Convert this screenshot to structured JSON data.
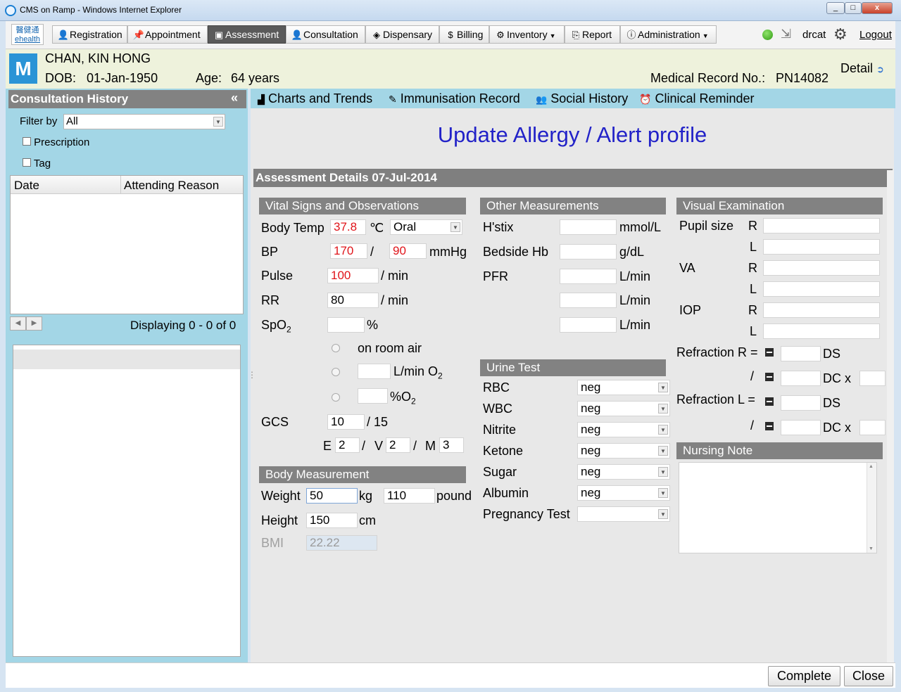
{
  "window": {
    "title": "CMS on Ramp - Windows Internet Explorer",
    "min": "_",
    "max": "□",
    "close": "x"
  },
  "logo": {
    "line1": "醫健通",
    "line2": "ehealth"
  },
  "nav": {
    "registration": "Registration",
    "appointment": "Appointment",
    "assessment": "Assessment",
    "consultation": "Consultation",
    "dispensary": "Dispensary",
    "billing": "Billing",
    "inventory": "Inventory",
    "report": "Report",
    "administration": "Administration",
    "user": "drcat",
    "logout": "Logout"
  },
  "patient": {
    "badge": "M",
    "name": "CHAN, KIN HONG",
    "dob_label": "DOB:",
    "dob": "01-Jan-1950",
    "age_label": "Age:",
    "age": "64 years",
    "mrn_label": "Medical Record No.:",
    "mrn": "PN14082",
    "detail": "Detail"
  },
  "history": {
    "title": "Consultation History",
    "filter_label": "Filter by",
    "filter_value": "All",
    "prescription": "Prescription",
    "tag": "Tag",
    "col_date": "Date",
    "col_reason": "Attending Reason",
    "displaying": "Displaying 0 - 0 of 0"
  },
  "tabs": {
    "charts": "Charts and Trends",
    "immunisation": "Immunisation Record",
    "social": "Social History",
    "reminder": "Clinical Reminder"
  },
  "main": {
    "title": "Update Allergy / Alert profile",
    "details_header": "Assessment Details 07-Jul-2014"
  },
  "vitals": {
    "header": "Vital Signs and Observations",
    "body_temp_label": "Body Temp",
    "body_temp": "37.8",
    "temp_unit": "℃",
    "temp_method": "Oral",
    "bp_label": "BP",
    "bp_sys": "170",
    "bp_sep": "/",
    "bp_dia": "90",
    "bp_unit": "mmHg",
    "pulse_label": "Pulse",
    "pulse": "100",
    "per_min": "/ min",
    "rr_label": "RR",
    "rr": "80",
    "spo2_label": "SpO",
    "spo2_sub": "2",
    "percent": "%",
    "room_air": "on room air",
    "lmin_o2": "L/min O",
    "pct_o2": "%O",
    "o2_sub": "2",
    "gcs_label": "GCS",
    "gcs": "10",
    "gcs_max": "/ 15",
    "e_label": "E",
    "e_val": "2",
    "v_label": "V",
    "v_val": "2",
    "m_label": "M",
    "m_val": "3"
  },
  "body": {
    "header": "Body Measurement",
    "weight_label": "Weight",
    "weight": "50",
    "kg": "kg",
    "pounds": "110",
    "pound": "pound",
    "height_label": "Height",
    "height": "150",
    "cm": "cm",
    "bmi_label": "BMI",
    "bmi": "22.22"
  },
  "other": {
    "header": "Other Measurements",
    "hstix_label": "H'stix",
    "hstix_unit": "mmol/L",
    "hb_label": "Bedside Hb",
    "hb_unit": "g/dL",
    "pfr_label": "PFR",
    "pfr_unit": "L/min"
  },
  "urine": {
    "header": "Urine Test",
    "rbc_label": "RBC",
    "rbc": "neg",
    "wbc_label": "WBC",
    "wbc": "neg",
    "nitrite_label": "Nitrite",
    "nitrite": "neg",
    "ketone_label": "Ketone",
    "ketone": "neg",
    "sugar_label": "Sugar",
    "sugar": "neg",
    "albumin_label": "Albumin",
    "albumin": "neg",
    "pregnancy_label": "Pregnancy Test",
    "pregnancy": ""
  },
  "visual": {
    "header": "Visual Examination",
    "pupil_label": "Pupil size",
    "va_label": "VA",
    "iop_label": "IOP",
    "r": "R",
    "l": "L",
    "refr_r_label": "Refraction R =",
    "refr_l_label": "Refraction L =",
    "slash": "/",
    "ds": "DS",
    "dcx": "DC x",
    "deg": "°"
  },
  "nursing": {
    "header": "Nursing Note"
  },
  "footer": {
    "complete": "Complete",
    "close": "Close"
  }
}
